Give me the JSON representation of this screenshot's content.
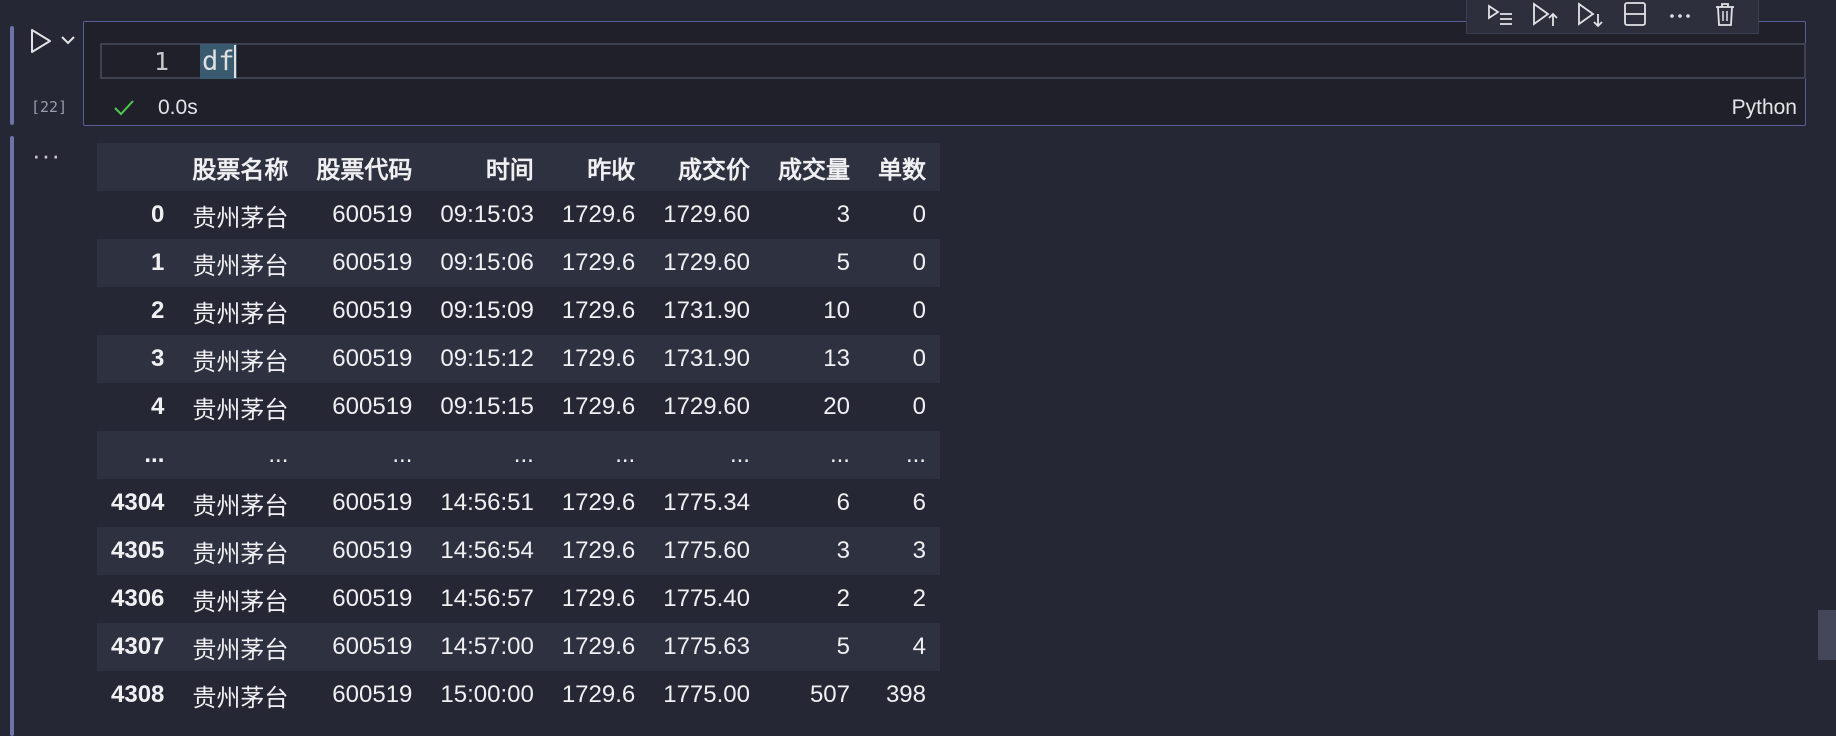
{
  "cell": {
    "execution_count": "[22]",
    "line_number": "1",
    "code": "df",
    "status_time": "0.0s",
    "language": "Python",
    "output_ellipsis": "···"
  },
  "icons": {
    "run": "play-icon",
    "run_menu": "chevron-down-icon",
    "status": "checkmark-icon",
    "toolbar": [
      "run-by-line-icon",
      "execute-above-icon",
      "execute-below-icon",
      "split-cell-icon",
      "more-icon",
      "delete-icon"
    ]
  },
  "colors": {
    "accent_border": "#585f95",
    "indicator_bar": "#6d72a8",
    "success_check": "#4ec94e",
    "selection": "#3a5a70"
  },
  "table": {
    "columns": [
      "",
      "股票名称",
      "股票代码",
      "时间",
      "昨收",
      "成交价",
      "成交量",
      "单数"
    ],
    "rows": [
      [
        "0",
        "贵州茅台",
        "600519",
        "09:15:03",
        "1729.6",
        "1729.60",
        "3",
        "0"
      ],
      [
        "1",
        "贵州茅台",
        "600519",
        "09:15:06",
        "1729.6",
        "1729.60",
        "5",
        "0"
      ],
      [
        "2",
        "贵州茅台",
        "600519",
        "09:15:09",
        "1729.6",
        "1731.90",
        "10",
        "0"
      ],
      [
        "3",
        "贵州茅台",
        "600519",
        "09:15:12",
        "1729.6",
        "1731.90",
        "13",
        "0"
      ],
      [
        "4",
        "贵州茅台",
        "600519",
        "09:15:15",
        "1729.6",
        "1729.60",
        "20",
        "0"
      ],
      [
        "...",
        "...",
        "...",
        "...",
        "...",
        "...",
        "...",
        "..."
      ],
      [
        "4304",
        "贵州茅台",
        "600519",
        "14:56:51",
        "1729.6",
        "1775.34",
        "6",
        "6"
      ],
      [
        "4305",
        "贵州茅台",
        "600519",
        "14:56:54",
        "1729.6",
        "1775.60",
        "3",
        "3"
      ],
      [
        "4306",
        "贵州茅台",
        "600519",
        "14:56:57",
        "1729.6",
        "1775.40",
        "2",
        "2"
      ],
      [
        "4307",
        "贵州茅台",
        "600519",
        "14:57:00",
        "1729.6",
        "1775.63",
        "5",
        "4"
      ],
      [
        "4308",
        "贵州茅台",
        "600519",
        "15:00:00",
        "1729.6",
        "1775.00",
        "507",
        "398"
      ]
    ]
  }
}
